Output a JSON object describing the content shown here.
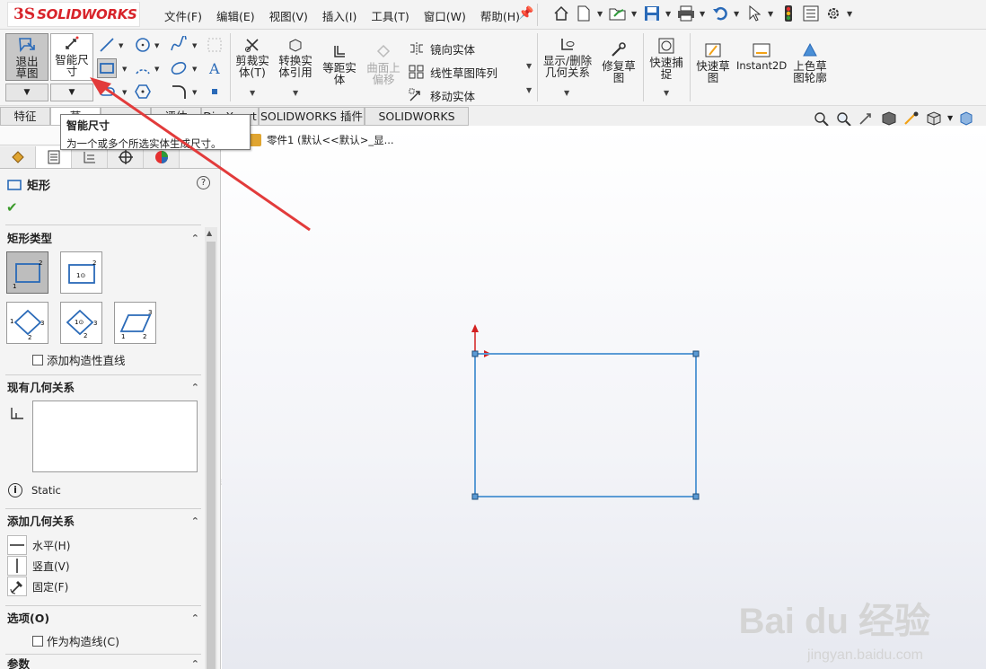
{
  "app": {
    "logo_ds": "3S",
    "logo_text": "SOLIDWORKS",
    "brand_color": "#d8242b"
  },
  "menu": [
    "文件(F)",
    "编辑(E)",
    "视图(V)",
    "插入(I)",
    "工具(T)",
    "窗口(W)",
    "帮助(H)"
  ],
  "ribbon": {
    "exit_sketch": "退出草图",
    "smart_dimension": "智能尺寸",
    "trim": "剪裁实体(T)",
    "convert": "转换实体引用",
    "offset": "等距实体",
    "surface_offset": "曲面上偏移",
    "mirror": "镜向实体",
    "linear_pattern": "线性草图阵列",
    "move": "移动实体",
    "display_relations": "显示/删除几何关系",
    "repair": "修复草图",
    "quick_snap": "快速捕捉",
    "rapid_sketch": "快速草图",
    "instant2d": "Instant2D",
    "shaded_contours": "上色草图轮廓"
  },
  "tabs": [
    "特征",
    "草图",
    "评估",
    "DimXpert",
    "SOLIDWORKS 插件",
    "SOLIDWORKS MBD"
  ],
  "tabs_visible_labels": [
    "特征",
    "草",
    "评估"
  ],
  "tooltip": {
    "title": "智能尺寸",
    "description": "为一个或多个所选实体生成尺寸。"
  },
  "panel": {
    "title": "矩形",
    "help": "?",
    "rect_type_header": "矩形类型",
    "add_construction": "添加构造性直线",
    "existing_relations_header": "现有几何关系",
    "status": "Static",
    "add_relations_header": "添加几何关系",
    "horizontal": "水平(H)",
    "vertical": "竖直(V)",
    "fixed": "固定(F)",
    "options_header": "选项(O)",
    "as_construction": "作为构造线(C)",
    "params_header": "参数"
  },
  "feature_tree": {
    "part": "零件1  (默认<<默认>_显..."
  },
  "watermark": {
    "main": "Bai du 经验",
    "sub": "jingyan.baidu.com"
  },
  "sketch_color": "#5b9bd5",
  "annotation_arrow_color": "#e23b3b"
}
